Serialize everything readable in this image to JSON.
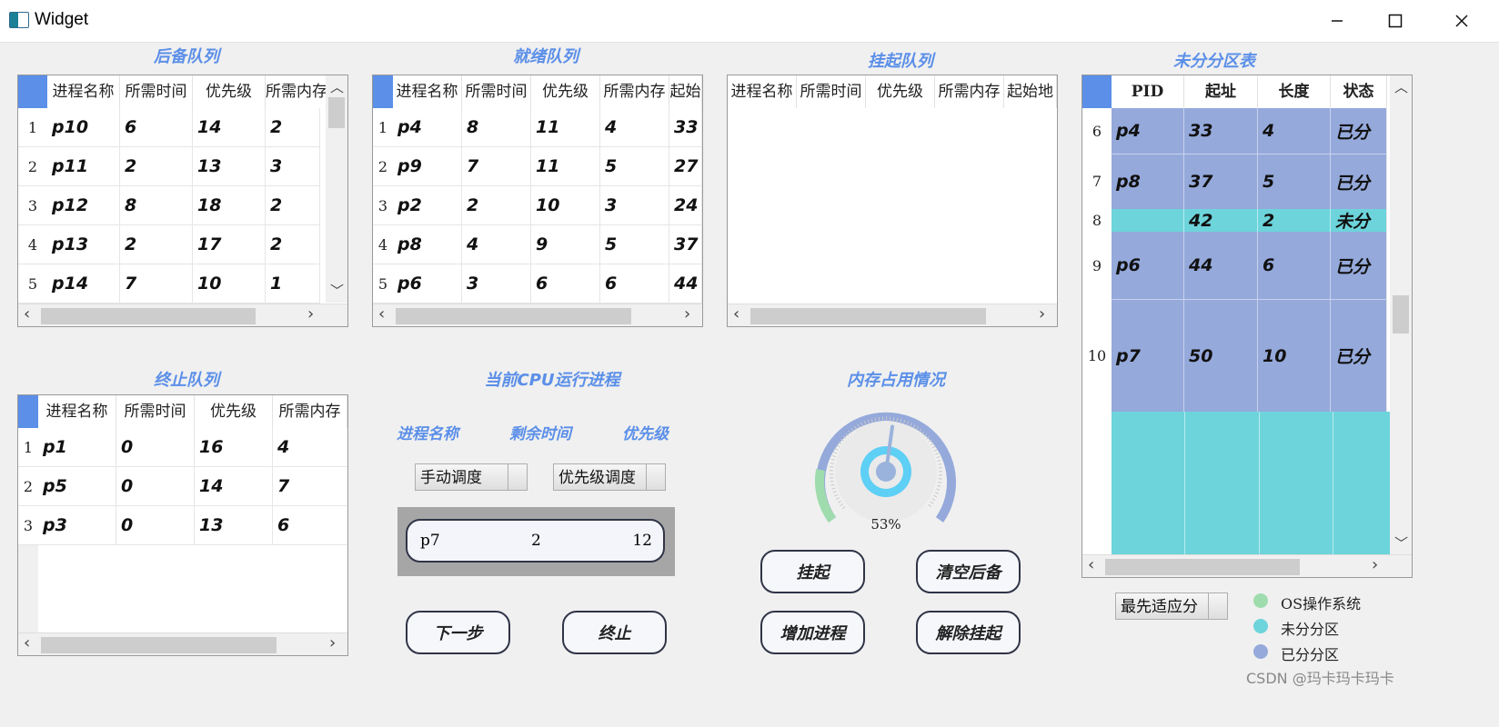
{
  "window": {
    "title": "Widget"
  },
  "sections": {
    "backup": "后备队列",
    "ready": "就绪队列",
    "suspend": "挂起队列",
    "free_table": "未分分区表",
    "terminate": "终止队列",
    "cpu": "当前CPU运行进程",
    "memory": "内存占用情况"
  },
  "backup_queue": {
    "headers": [
      "进程名称",
      "所需时间",
      "优先级",
      "所需内存"
    ],
    "rows": [
      {
        "num": "1",
        "name": "p10",
        "time": "6",
        "prio": "14",
        "mem": "2"
      },
      {
        "num": "2",
        "name": "p11",
        "time": "2",
        "prio": "13",
        "mem": "3"
      },
      {
        "num": "3",
        "name": "p12",
        "time": "8",
        "prio": "18",
        "mem": "2"
      },
      {
        "num": "4",
        "name": "p13",
        "time": "2",
        "prio": "17",
        "mem": "2"
      },
      {
        "num": "5",
        "name": "p14",
        "time": "7",
        "prio": "10",
        "mem": "1"
      }
    ]
  },
  "ready_queue": {
    "headers": [
      "进程名称",
      "所需时间",
      "优先级",
      "所需内存",
      "起始"
    ],
    "rows": [
      {
        "num": "1",
        "name": "p4",
        "time": "8",
        "prio": "11",
        "mem": "4",
        "start": "33"
      },
      {
        "num": "2",
        "name": "p9",
        "time": "7",
        "prio": "11",
        "mem": "5",
        "start": "27"
      },
      {
        "num": "3",
        "name": "p2",
        "time": "2",
        "prio": "10",
        "mem": "3",
        "start": "24"
      },
      {
        "num": "4",
        "name": "p8",
        "time": "4",
        "prio": "9",
        "mem": "5",
        "start": "37"
      },
      {
        "num": "5",
        "name": "p6",
        "time": "3",
        "prio": "6",
        "mem": "6",
        "start": "44"
      }
    ]
  },
  "suspend_queue": {
    "headers": [
      "进程名称",
      "所需时间",
      "优先级",
      "所需内存",
      "起始地"
    ]
  },
  "partition_table": {
    "headers": [
      "PID",
      "起址",
      "长度",
      "状态"
    ],
    "rows": [
      {
        "num": "6",
        "pid": "p4",
        "start": "33",
        "len": "4",
        "state": "已分"
      },
      {
        "num": "7",
        "pid": "p8",
        "start": "37",
        "len": "5",
        "state": "已分"
      },
      {
        "num": "8",
        "pid": "",
        "start": "42",
        "len": "2",
        "state": "未分"
      },
      {
        "num": "9",
        "pid": "p6",
        "start": "44",
        "len": "6",
        "state": "已分"
      },
      {
        "num": "10",
        "pid": "p7",
        "start": "50",
        "len": "10",
        "state": "已分"
      }
    ],
    "colors": {
      "allocated": "#95a9db",
      "free": "#6dd4db",
      "os": "#9fdcad"
    }
  },
  "terminate_queue": {
    "headers": [
      "进程名称",
      "所需时间",
      "优先级",
      "所需内存"
    ],
    "rows": [
      {
        "num": "1",
        "name": "p1",
        "time": "0",
        "prio": "16",
        "mem": "4"
      },
      {
        "num": "2",
        "name": "p5",
        "time": "0",
        "prio": "14",
        "mem": "7"
      },
      {
        "num": "3",
        "name": "p3",
        "time": "0",
        "prio": "13",
        "mem": "6"
      }
    ]
  },
  "cpu_panel": {
    "labels": {
      "name": "进程名称",
      "remain": "剩余时间",
      "prio": "优先级"
    },
    "running": {
      "name": "p7",
      "remain": "2",
      "prio": "12"
    },
    "combo_schedule": "手动调度",
    "combo_algorithm": "优先级调度",
    "next_button": "下一步",
    "terminate_button": "终止"
  },
  "memory_panel": {
    "percent_label": "53%",
    "usage": 0.53,
    "suspend_button": "挂起",
    "clear_button": "清空后备",
    "add_button": "增加进程",
    "resume_button": "解除挂起"
  },
  "allocation": {
    "combo": "最先适应分"
  },
  "legend": [
    {
      "label": "OS操作系统",
      "color": "#9fdcad"
    },
    {
      "label": "未分分区",
      "color": "#6dd4db"
    },
    {
      "label": "已分分区",
      "color": "#95a9db"
    }
  ],
  "watermark": "CSDN @玛卡玛卡玛卡"
}
